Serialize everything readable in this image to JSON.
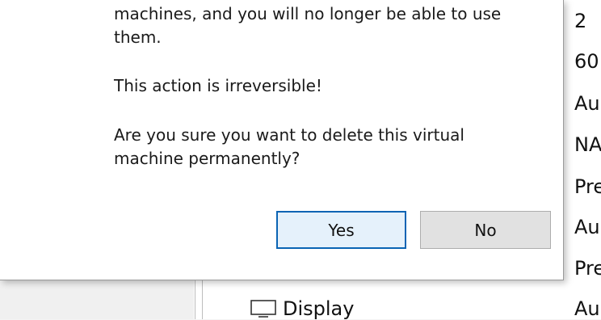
{
  "dialog": {
    "message_lines_1": [
      "machines, and you will no longer be able to use",
      "them."
    ],
    "warning": "This action is irreversible!",
    "question_lines": [
      "Are you sure you want to delete this virtual",
      "machine permanently?"
    ],
    "yes_label": "Yes",
    "no_label": "No"
  },
  "background": {
    "values": [
      "2",
      "60",
      "Au",
      "NA",
      "Pre",
      "Au",
      "Pre",
      "Au"
    ],
    "display_label": "Display"
  },
  "colors": {
    "default_button_border": "#0a64b4",
    "button_bg": "#e1e1e1"
  }
}
